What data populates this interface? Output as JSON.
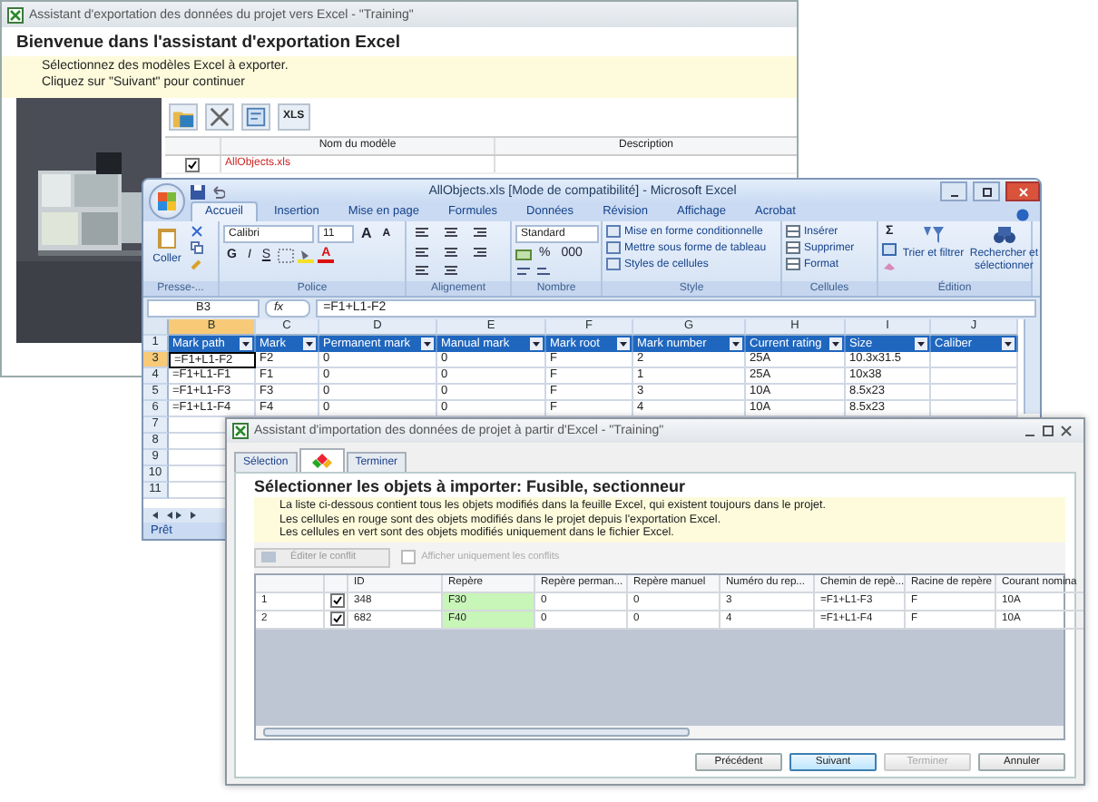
{
  "export_window": {
    "title": "Assistant d'exportation des données du projet vers Excel - \"Training\"",
    "heading": "Bienvenue dans l'assistant d'exportation Excel",
    "instructions": [
      "Sélectionnez des modèles Excel à exporter.",
      "Cliquez sur \"Suivant\" pour continuer"
    ],
    "picture": {
      "kind": "picture"
    },
    "toolbar": [
      {
        "kind": "open"
      },
      {
        "kind": "delete"
      },
      {
        "kind": "properties"
      },
      {
        "kind": "xls",
        "label": "XLS"
      }
    ],
    "columns": [
      "Nom du modèle",
      "Description"
    ],
    "rows": [
      {
        "checked": true,
        "name": "AllObjects.xls"
      }
    ]
  },
  "excel_window": {
    "title": "AllObjects.xls  [Mode de compatibilité] - Microsoft Excel",
    "tabs": [
      {
        "label": "Accueil",
        "selected": true
      },
      {
        "label": "Insertion",
        "selected": false
      },
      {
        "label": "Mise en page",
        "selected": false
      },
      {
        "label": "Formules",
        "selected": false
      },
      {
        "label": "Données",
        "selected": false
      },
      {
        "label": "Révision",
        "selected": false
      },
      {
        "label": "Affichage",
        "selected": false
      },
      {
        "label": "Acrobat",
        "selected": false
      }
    ],
    "ribbon": {
      "paste": "Coller",
      "font": "Calibri",
      "size": "11",
      "grow": "A",
      "shrink": "A",
      "bold": "G",
      "italic": "I",
      "underline": "S",
      "font_color": "A",
      "number_format": "Standard",
      "percent": "%",
      "thousands": "000",
      "styles": [
        "Mise en forme conditionnelle",
        "Mettre sous forme de tableau",
        "Styles de cellules"
      ],
      "cells": [
        "Insérer",
        "Supprimer",
        "Format"
      ],
      "sum": "Σ",
      "sort": "Trier et filtrer",
      "find": "Rechercher et sélectionner",
      "groups": [
        "Presse-...",
        "Police",
        "Alignement",
        "Nombre",
        "Style",
        "Cellules",
        "Édition"
      ]
    },
    "name_box": "B3",
    "fx": "fx",
    "formula": "=F1+L1-F2",
    "column_letters": [
      {
        "label": "B",
        "selected": true
      },
      {
        "label": "C",
        "selected": false
      },
      {
        "label": "D",
        "selected": false
      },
      {
        "label": "E",
        "selected": false
      },
      {
        "label": "F",
        "selected": false
      },
      {
        "label": "G",
        "selected": false
      },
      {
        "label": "H",
        "selected": false
      },
      {
        "label": "I",
        "selected": false
      },
      {
        "label": "J",
        "selected": false
      }
    ],
    "header_row": {
      "number": "1",
      "cells": [
        "Mark path",
        "Mark",
        "Permanent mark",
        "Manual mark",
        "Mark root",
        "Mark number",
        "Current rating",
        "Size",
        "Caliber"
      ]
    },
    "rows": [
      {
        "number": "3",
        "selected": true,
        "cells": [
          "=F1+L1-F2",
          "F2",
          "0",
          "0",
          "F",
          "2",
          "25A",
          "10.3x31.5"
        ]
      },
      {
        "number": "4",
        "selected": false,
        "cells": [
          "=F1+L1-F1",
          "F1",
          "0",
          "0",
          "F",
          "1",
          "25A",
          "10x38"
        ]
      },
      {
        "number": "5",
        "selected": false,
        "cells": [
          "=F1+L1-F3",
          "F3",
          "0",
          "0",
          "F",
          "3",
          "10A",
          "8.5x23"
        ]
      },
      {
        "number": "6",
        "selected": false,
        "cells": [
          "=F1+L1-F4",
          "F4",
          "0",
          "0",
          "F",
          "4",
          "10A",
          "8.5x23"
        ]
      }
    ],
    "empty_rows": [
      "7",
      "8",
      "9",
      "10",
      "11"
    ],
    "status": "Prêt"
  },
  "import_window": {
    "title": "Assistant d'importation des données de projet à partir d'Excel - \"Training\"",
    "tabs": [
      {
        "kind": "text",
        "label": "Sélection",
        "selected": false
      },
      {
        "kind": "icon",
        "selected": true
      },
      {
        "kind": "text",
        "label": "Terminer",
        "selected": false
      }
    ],
    "heading": "Sélectionner les objets à importer: Fusible, sectionneur",
    "instructions": [
      "La liste ci-dessous contient tous les objets modifiés dans la feuille Excel, qui existent toujours dans le projet.",
      "Les cellules en rouge sont des objets modifiés dans le projet depuis l'exportation Excel.",
      "Les cellules en vert sont des objets modifiés uniquement dans le fichier Excel."
    ],
    "conflict_button": {
      "label": "Éditer le conflit",
      "disabled": true
    },
    "conflicts_only": {
      "label": "Afficher uniquement les conflits",
      "checked": false,
      "disabled": true
    },
    "columns": [
      "ID",
      "Repère",
      "Repère perman...",
      "Repère manuel",
      "Numéro du rep...",
      "Chemin de repè...",
      "Racine de repère",
      "Courant nomina"
    ],
    "rows": [
      {
        "number": "1",
        "checked": true,
        "color": "#c8f5b8",
        "cells": [
          "348",
          "F30",
          "0",
          "0",
          "3",
          "=F1+L1-F3",
          "F",
          "10A"
        ]
      },
      {
        "number": "2",
        "checked": true,
        "color": "#c8f5b8",
        "cells": [
          "682",
          "F40",
          "0",
          "0",
          "4",
          "=F1+L1-F4",
          "F",
          "10A"
        ]
      }
    ],
    "buttons": [
      {
        "label": "Précédent",
        "disabled": false,
        "default": false
      },
      {
        "label": "Suivant",
        "disabled": false,
        "default": true
      },
      {
        "label": "Terminer",
        "disabled": true,
        "default": false
      },
      {
        "label": "Annuler",
        "disabled": false,
        "default": false
      }
    ]
  }
}
